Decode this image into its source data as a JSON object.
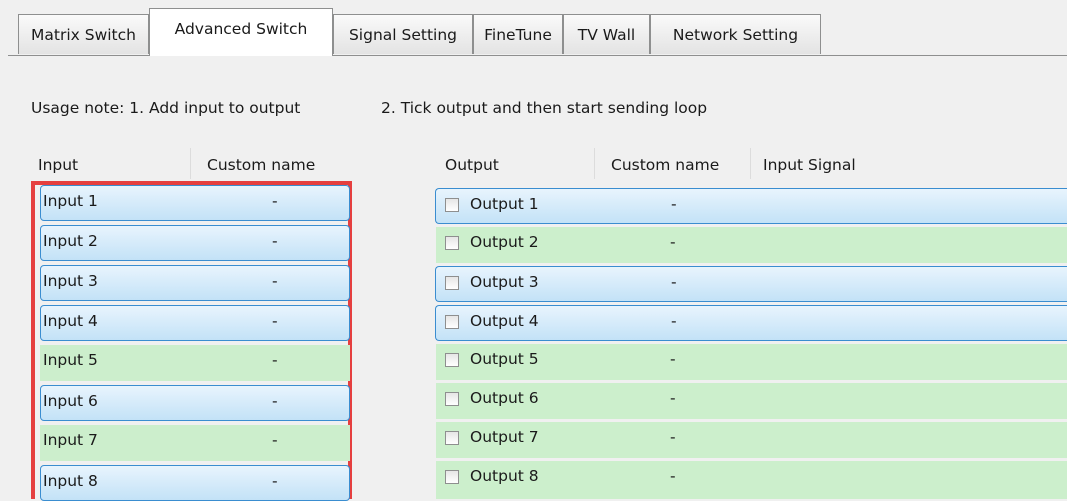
{
  "tabs": [
    {
      "label": "Matrix Switch",
      "active": false
    },
    {
      "label": "Advanced Switch",
      "active": true
    },
    {
      "label": "Signal Setting",
      "active": false
    },
    {
      "label": "FineTune",
      "active": false
    },
    {
      "label": "TV Wall",
      "active": false
    },
    {
      "label": "Network Setting",
      "active": false
    }
  ],
  "usage_note": {
    "part1": "Usage note: 1. Add input to output",
    "part2": "2. Tick output and then start sending loop"
  },
  "input_table": {
    "headers": {
      "input": "Input",
      "custom_name": "Custom name"
    },
    "rows": [
      {
        "label": "Input  1",
        "custom_name": "-",
        "style": "blue"
      },
      {
        "label": "Input  2",
        "custom_name": "-",
        "style": "blue"
      },
      {
        "label": "Input  3",
        "custom_name": "-",
        "style": "blue"
      },
      {
        "label": "Input  4",
        "custom_name": "-",
        "style": "blue"
      },
      {
        "label": "Input  5",
        "custom_name": "-",
        "style": "green"
      },
      {
        "label": "Input  6",
        "custom_name": "-",
        "style": "blue"
      },
      {
        "label": "Input  7",
        "custom_name": "-",
        "style": "green"
      },
      {
        "label": "Input  8",
        "custom_name": "-",
        "style": "blue"
      }
    ]
  },
  "output_table": {
    "headers": {
      "output": "Output",
      "custom_name": "Custom name",
      "input_signal": "Input Signal"
    },
    "rows": [
      {
        "label": "Output  1",
        "custom_name": "-",
        "input_signal": "",
        "checked": false,
        "style": "blue"
      },
      {
        "label": "Output  2",
        "custom_name": "-",
        "input_signal": "",
        "checked": false,
        "style": "green"
      },
      {
        "label": "Output  3",
        "custom_name": "-",
        "input_signal": "",
        "checked": false,
        "style": "blue"
      },
      {
        "label": "Output  4",
        "custom_name": "-",
        "input_signal": "",
        "checked": false,
        "style": "blue"
      },
      {
        "label": "Output  5",
        "custom_name": "-",
        "input_signal": "",
        "checked": false,
        "style": "green"
      },
      {
        "label": "Output  6",
        "custom_name": "-",
        "input_signal": "",
        "checked": false,
        "style": "green"
      },
      {
        "label": "Output  7",
        "custom_name": "-",
        "input_signal": "",
        "checked": false,
        "style": "green"
      },
      {
        "label": "Output  8",
        "custom_name": "-",
        "input_signal": "",
        "checked": false,
        "style": "green"
      }
    ]
  },
  "colors": {
    "highlight_border": "#e53f3f",
    "row_blue": "#c3e2f7",
    "row_green": "#cceecc"
  }
}
